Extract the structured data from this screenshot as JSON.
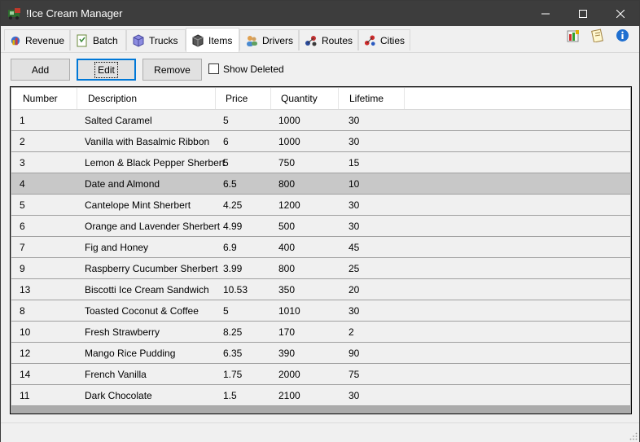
{
  "window": {
    "title": "!Ice Cream Manager"
  },
  "tabs": [
    {
      "label": "Revenue",
      "icon": "revenue-icon",
      "active": false
    },
    {
      "label": "Batch",
      "icon": "batch-icon",
      "active": false
    },
    {
      "label": "Trucks",
      "icon": "trucks-icon",
      "active": false
    },
    {
      "label": "Items",
      "icon": "items-icon",
      "active": true
    },
    {
      "label": "Drivers",
      "icon": "drivers-icon",
      "active": false
    },
    {
      "label": "Routes",
      "icon": "routes-icon",
      "active": false
    },
    {
      "label": "Cities",
      "icon": "cities-icon",
      "active": false
    }
  ],
  "toolbar": {
    "add_label": "Add",
    "edit_label": "Edit",
    "remove_label": "Remove",
    "show_deleted_label": "Show Deleted",
    "show_deleted_checked": false
  },
  "table": {
    "columns": [
      "Number",
      "Description",
      "Price",
      "Quantity",
      "Lifetime"
    ],
    "selected_row_index": 3,
    "rows": [
      [
        "1",
        "Salted Caramel",
        "5",
        "1000",
        "30"
      ],
      [
        "2",
        "Vanilla with Basalmic Ribbon",
        "6",
        "1000",
        "30"
      ],
      [
        "3",
        "Lemon & Black Pepper Sherbert",
        "5",
        "750",
        "15"
      ],
      [
        "4",
        "Date and Almond",
        "6.5",
        "800",
        "10"
      ],
      [
        "5",
        "Cantelope Mint Sherbert",
        "4.25",
        "1200",
        "30"
      ],
      [
        "6",
        "Orange and Lavender Sherbert",
        "4.99",
        "500",
        "30"
      ],
      [
        "7",
        "Fig and Honey",
        "6.9",
        "400",
        "45"
      ],
      [
        "9",
        "Raspberry Cucumber Sherbert",
        "3.99",
        "800",
        "25"
      ],
      [
        "13",
        "Biscotti Ice Cream Sandwich",
        "10.53",
        "350",
        "20"
      ],
      [
        "8",
        "Toasted Coconut & Coffee",
        "5",
        "1010",
        "30"
      ],
      [
        "10",
        "Fresh Strawberry",
        "8.25",
        "170",
        "2"
      ],
      [
        "12",
        "Mango Rice Pudding",
        "6.35",
        "390",
        "90"
      ],
      [
        "14",
        "French Vanilla",
        "1.75",
        "2000",
        "75"
      ],
      [
        "11",
        "Dark Chocolate",
        "1.5",
        "2100",
        "30"
      ]
    ]
  },
  "colors": {
    "titlebar": "#3d3d3d",
    "selected_row": "#c8c8c8",
    "focus_border": "#0078d7"
  }
}
